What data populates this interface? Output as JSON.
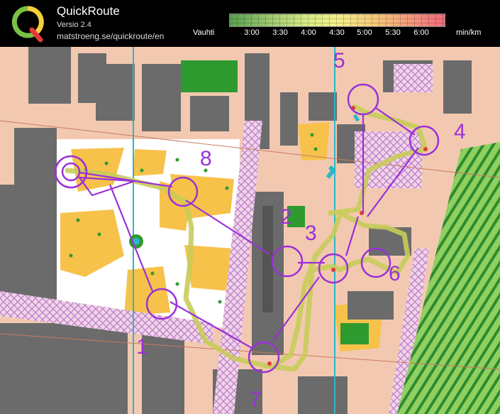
{
  "header": {
    "app_title": "QuickRoute",
    "version": "Versio 2.4",
    "url": "matstroeng.se/quickroute/en",
    "pace_label": "Vauhti",
    "pace_ticks": [
      "3:00",
      "3:30",
      "4:00",
      "4:30",
      "5:00",
      "5:30",
      "6:00"
    ],
    "pace_unit": "min/km"
  },
  "map": {
    "controls": [
      {
        "number": "1",
        "label": "1"
      },
      {
        "number": "2",
        "label": "2"
      },
      {
        "number": "3",
        "label": "3"
      },
      {
        "number": "4",
        "label": "4"
      },
      {
        "number": "5",
        "label": "5"
      },
      {
        "number": "6",
        "label": "6"
      },
      {
        "number": "7",
        "label": "7"
      },
      {
        "number": "8",
        "label": "8"
      }
    ]
  },
  "colors": {
    "course_purple": "#9b30d8",
    "building_gray": "#6b6b6b",
    "paved_area": "#f2c9b0",
    "open_land": "#f6c24a",
    "vegetation_green": "#2f9a2f",
    "water_blue": "#2bb7c7",
    "route_line": "#c8cc5a"
  }
}
